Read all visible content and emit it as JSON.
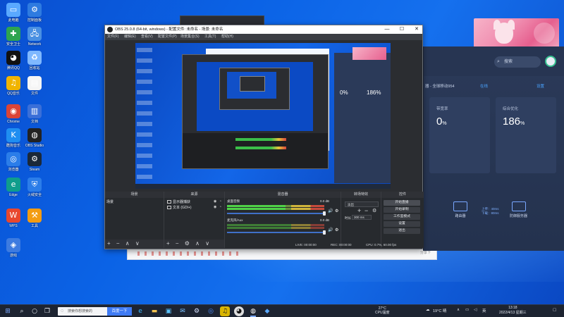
{
  "desktop": {
    "icons": [
      {
        "label": "此电脑",
        "icon": "computer-icon",
        "color": "#5aa9ff",
        "glyph": "▭"
      },
      {
        "label": "控制面板",
        "icon": "control-panel-icon",
        "color": "#2e7be0",
        "glyph": "⚙"
      },
      {
        "label": "安全卫士",
        "icon": "security-shield-icon",
        "color": "#2ea44f",
        "glyph": "✚"
      },
      {
        "label": "Network",
        "icon": "network-icon",
        "color": "#4a90e2",
        "glyph": "🖧"
      },
      {
        "label": "腾讯QQ",
        "icon": "qq-icon",
        "color": "#111111",
        "glyph": "◕"
      },
      {
        "label": "回收站",
        "icon": "recycle-bin-icon",
        "color": "#7fb8ff",
        "glyph": "♻"
      },
      {
        "label": "QQ音乐",
        "icon": "music-icon",
        "color": "#f0b400",
        "glyph": "♫"
      },
      {
        "label": "文件",
        "icon": "file-icon",
        "color": "#f5f5f5",
        "glyph": "▤"
      },
      {
        "label": "Chrome",
        "icon": "chrome-icon",
        "color": "#db4437",
        "glyph": "◉"
      },
      {
        "label": "文档",
        "icon": "document-icon",
        "color": "#3a6fd8",
        "glyph": "▥"
      },
      {
        "label": "酷狗音乐",
        "icon": "kugou-icon",
        "color": "#1f8ef1",
        "glyph": "K"
      },
      {
        "label": "OBS Studio",
        "icon": "obs-icon",
        "color": "#222222",
        "glyph": "◍"
      },
      {
        "label": "浏览器",
        "icon": "browser-icon",
        "color": "#2b7de9",
        "glyph": "◎"
      },
      {
        "label": "Steam",
        "icon": "steam-icon",
        "color": "#1b2838",
        "glyph": "⚙"
      },
      {
        "label": "Edge",
        "icon": "edge-icon",
        "color": "#0f9d8c",
        "glyph": "e"
      },
      {
        "label": "火绒安全",
        "icon": "antivirus-icon",
        "color": "#2b7de9",
        "glyph": "⛨"
      },
      {
        "label": "WPS",
        "icon": "wps-icon",
        "color": "#e8472e",
        "glyph": "W"
      },
      {
        "label": "工具",
        "icon": "tool-icon",
        "color": "#f39c12",
        "glyph": "⚒"
      },
      {
        "label": "游戏",
        "icon": "game-icon",
        "color": "#3d7be0",
        "glyph": "◈"
      }
    ]
  },
  "obs": {
    "title": "OBS 25.0.8 (64-bit, windows) - 配置文件: 未命名 - 场景: 未命名",
    "menu": [
      "文件(F)",
      "编辑(E)",
      "查看(V)",
      "配置文件(P)",
      "场景集合(S)",
      "工具(T)",
      "帮助(H)"
    ],
    "window_controls": {
      "minimize": "—",
      "maximize": "☐",
      "close": "✕"
    },
    "panels": {
      "scenes": "场景",
      "sources": "来源",
      "mixer": "混音器",
      "transitions": "转场特效",
      "controls": "控件"
    },
    "scene_item": "场景",
    "sources": [
      {
        "label": "显示器捕获",
        "type": "monitor"
      },
      {
        "label": "文本 (GDI+)",
        "type": "text"
      }
    ],
    "footer_buttons": "+ − ∧ ∨",
    "source_footer_buttons": "+ − ⚙ ∧ ∨",
    "mixer": [
      {
        "name": "桌面音频",
        "db": "0.0 dB",
        "level": 0.66
      },
      {
        "name": "麦克风/Aux",
        "db": "0.0 dB",
        "level": 0.6
      }
    ],
    "transition": {
      "selected": "淡出",
      "duration_label": "时长",
      "duration_value": "300 ms"
    },
    "controls": [
      "开始直播",
      "开始录制",
      "工作室模式",
      "设置",
      "退出"
    ],
    "status": {
      "live": "LIVE: 00:00:00",
      "rec": "REC: 00:00:00",
      "cpu": "CPU: 0.7%, 60.00 fps"
    }
  },
  "preview": {
    "router_value_1": "0%",
    "router_value_2": "186%"
  },
  "router_app": {
    "search_placeholder": "搜索",
    "status_name": "器 - 全球移动954",
    "status_online": "在线",
    "settings": "设置",
    "cards": [
      {
        "label": "带宽率",
        "value": "0",
        "unit": "%"
      },
      {
        "label": "综合优化",
        "value": "186",
        "unit": "%"
      }
    ],
    "speed_text": "上传：40ms\n下载：80ms",
    "devices": [
      {
        "label": "路由器"
      },
      {
        "label": "防御服务器"
      }
    ]
  },
  "browser_bg": {
    "share_icon": "share-icon",
    "footer_right": "分享下"
  },
  "taskbar": {
    "search_placeholder": "搜索你想搜索的",
    "search_button": "百度一下",
    "weather": {
      "temp": "27°C",
      "desc": "CPU温度"
    },
    "weather_right": "19°C 晴",
    "tray_text": "英",
    "clock_time": "13:18",
    "clock_date": "2022/4/13 星期三",
    "colors": {
      "accent": "#3f7bf4",
      "bar": "#1d2431"
    }
  }
}
